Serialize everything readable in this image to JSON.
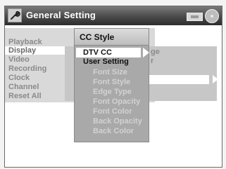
{
  "window": {
    "title": "General Setting",
    "icons": [
      "wrench-icon",
      "vcr-icon",
      "disc-icon"
    ]
  },
  "main_menu": {
    "items": [
      "Playback",
      "Display",
      "Video",
      "Recording",
      "Clock",
      "Channel",
      "Reset All"
    ],
    "selected_index": 1
  },
  "submenu": {
    "fragments": [
      "ge",
      "r"
    ]
  },
  "cc_style": {
    "title": "CC Style",
    "items": [
      "DTV CC",
      "User Setting",
      "Font Size",
      "Font Style",
      "Edge Type",
      "Font Opacity",
      "Font Color",
      "Back Opacity",
      "Back Color"
    ],
    "selected_index": 0
  },
  "colors": {
    "title_bar": "#3a3a3a",
    "menu_bg": "#d9d9d9",
    "cc_panel_bg": "#a9a9a9",
    "highlight": "#ffffff"
  }
}
